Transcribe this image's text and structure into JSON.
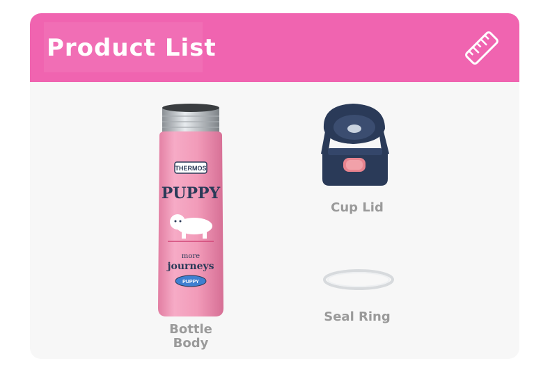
{
  "header": {
    "title": "Product List",
    "icon": "ruler-icon",
    "background": "#f064b0"
  },
  "products": [
    {
      "label": "Bottle Body",
      "icon": "bottle-image",
      "print": {
        "brand": "THERMOS",
        "headline": "PUPPY",
        "line1": "more",
        "line2": "journeys",
        "badge": "PUPPY"
      }
    },
    {
      "label": "Cup Lid",
      "icon": "cup-lid-image"
    },
    {
      "label": "Seal Ring",
      "icon": "seal-ring-image"
    }
  ],
  "colors": {
    "bottle_pink": "#f29bb9",
    "lid_navy": "#2a3a58",
    "label_gray": "#9a9a9a"
  }
}
